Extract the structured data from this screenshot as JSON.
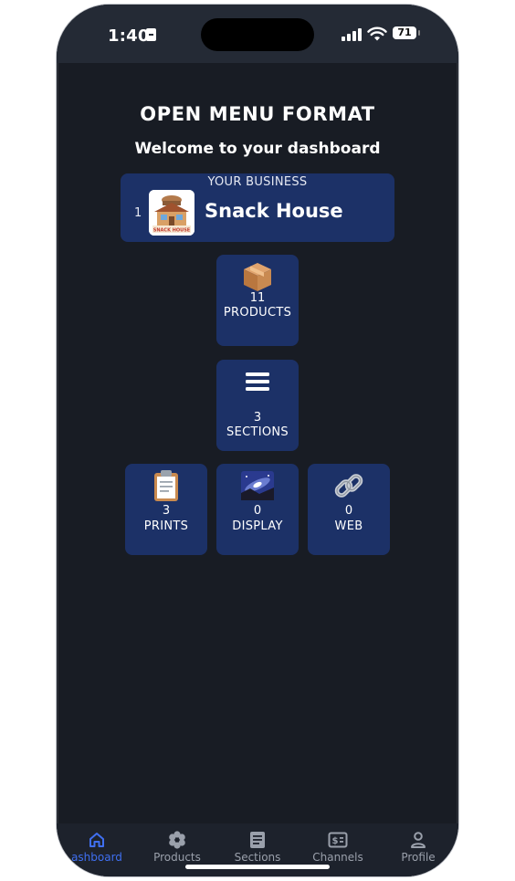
{
  "status_bar": {
    "time": "1:40",
    "battery": "71"
  },
  "header": {
    "title": "OPEN MENU FORMAT",
    "welcome": "Welcome to your dashboard"
  },
  "business": {
    "caption": "YOUR BUSINESS",
    "index": "1",
    "name": "Snack House",
    "logo_text": "SNACK HOUSE"
  },
  "tiles": {
    "products": {
      "count": "11",
      "label": "PRODUCTS"
    },
    "sections": {
      "count": "3",
      "label": "SECTIONS"
    },
    "prints": {
      "count": "3",
      "label": "PRINTS"
    },
    "display": {
      "count": "0",
      "label": "DISPLAY"
    },
    "web": {
      "count": "0",
      "label": "WEB"
    }
  },
  "tab_bar": {
    "items": [
      {
        "label": "ashboard",
        "icon": "home-icon"
      },
      {
        "label": "Products",
        "icon": "flower-icon"
      },
      {
        "label": "Sections",
        "icon": "document-icon"
      },
      {
        "label": "Channels",
        "icon": "money-icon"
      },
      {
        "label": "Profile",
        "icon": "person-icon"
      }
    ]
  },
  "colors": {
    "background": "#181c24",
    "card": "#1c3167",
    "accent": "#3f6ff0"
  }
}
